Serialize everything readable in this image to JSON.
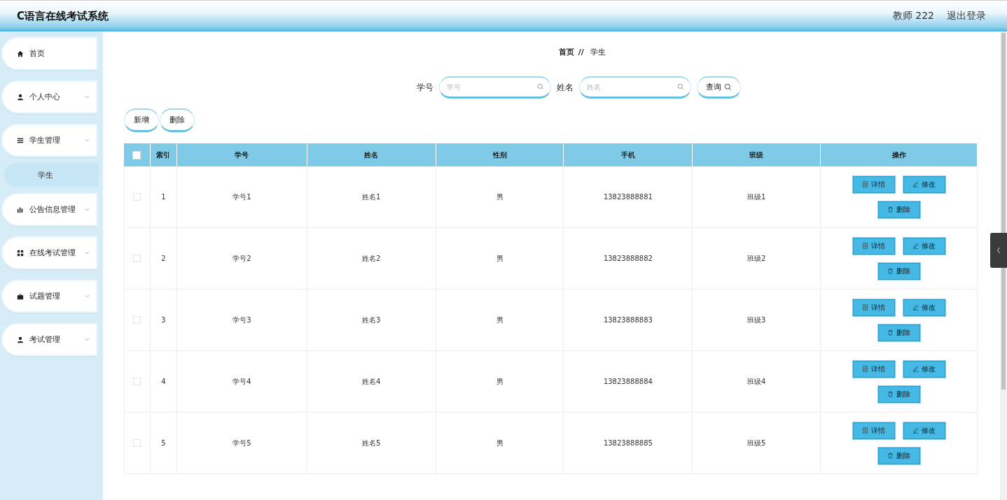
{
  "header": {
    "title": "C语言在线考试系统",
    "user": "教师 222",
    "logout": "退出登录"
  },
  "sidebar": {
    "items": [
      {
        "label": "首页",
        "kind": "link"
      },
      {
        "label": "个人中心",
        "kind": "menu"
      },
      {
        "label": "学生管理",
        "kind": "menu",
        "children": [
          {
            "label": "学生",
            "selected": true
          }
        ]
      },
      {
        "label": "公告信息管理",
        "kind": "menu"
      },
      {
        "label": "在线考试管理",
        "kind": "menu"
      },
      {
        "label": "试题管理",
        "kind": "menu"
      },
      {
        "label": "考试管理",
        "kind": "menu"
      }
    ]
  },
  "breadcrumb": {
    "items": [
      "首页",
      "学生"
    ],
    "separator": "//"
  },
  "search": {
    "fields": [
      {
        "label": "学号",
        "placeholder": "学号"
      },
      {
        "label": "姓名",
        "placeholder": "姓名"
      }
    ],
    "button": "查询"
  },
  "toolbar": {
    "buttons": [
      "新增",
      "删除"
    ]
  },
  "table": {
    "select_all_checked": false,
    "columns": [
      "索引",
      "学号",
      "姓名",
      "性别",
      "手机",
      "班级",
      "操作"
    ],
    "rows": [
      {
        "checked": false,
        "cells": [
          "1",
          "学号1",
          "姓名1",
          "男",
          "13823888881",
          "班级1"
        ],
        "actions": [
          "详情",
          "修改",
          "删除"
        ]
      },
      {
        "checked": false,
        "cells": [
          "2",
          "学号2",
          "姓名2",
          "男",
          "13823888882",
          "班级2"
        ],
        "actions": [
          "详情",
          "修改",
          "删除"
        ]
      },
      {
        "checked": false,
        "cells": [
          "3",
          "学号3",
          "姓名3",
          "男",
          "13823888883",
          "班级3"
        ],
        "actions": [
          "详情",
          "修改",
          "删除"
        ]
      },
      {
        "checked": false,
        "cells": [
          "4",
          "学号4",
          "姓名4",
          "男",
          "13823888884",
          "班级4"
        ],
        "actions": [
          "详情",
          "修改",
          "删除"
        ]
      },
      {
        "checked": false,
        "cells": [
          "5",
          "学号5",
          "姓名5",
          "男",
          "13823888885",
          "班级5"
        ],
        "actions": [
          "详情",
          "修改",
          "删除"
        ]
      }
    ]
  }
}
